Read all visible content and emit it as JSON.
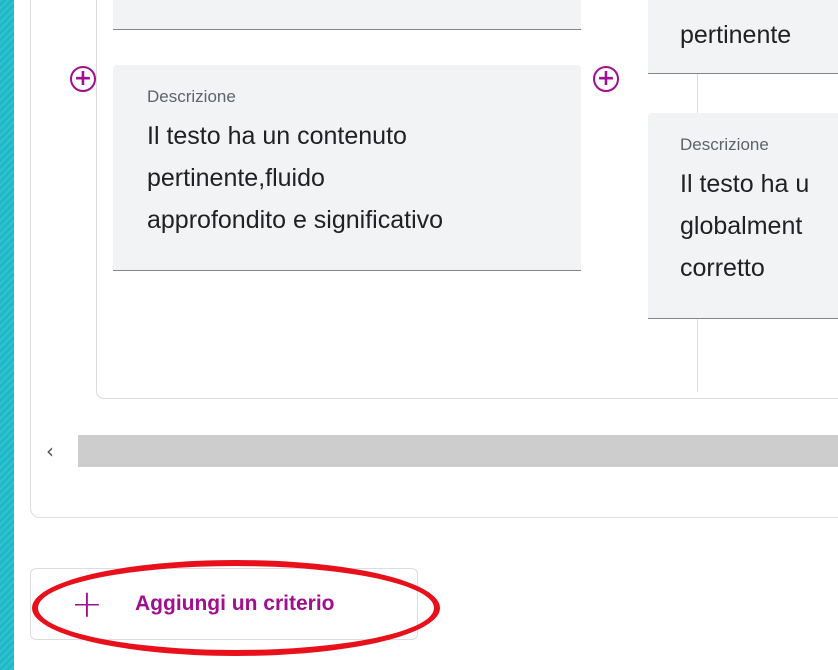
{
  "levels": [
    {
      "caption": "Descrizione",
      "description": [
        "Il testo ha un contenuto",
        "pertinente,fluido",
        "approfondito e significativo"
      ]
    },
    {
      "title_partial": "pertinente",
      "caption": "Descrizione",
      "description": [
        "Il testo ha u",
        "globalment",
        "corretto"
      ]
    }
  ],
  "scrollbar": {
    "left_arrow": "‹"
  },
  "add_criterion": {
    "icon": "plus-icon",
    "label": "Aggiungi un criterio"
  },
  "colors": {
    "accent": "#a00f8f",
    "highlight": "#e8101b",
    "frame": "#1eb9c8"
  }
}
